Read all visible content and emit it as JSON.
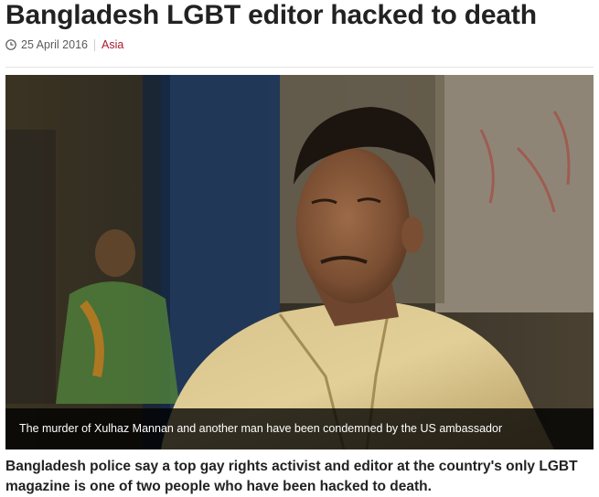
{
  "article": {
    "headline": "Bangladesh LGBT editor hacked to death",
    "date": "25 April 2016",
    "section": "Asia",
    "image": {
      "caption": "The murder of Xulhaz Mannan and another man have been condemned by the US ambassador"
    },
    "intro": "Bangladesh police say a top gay rights activist and editor at the country's only LGBT magazine is one of two people who have been hacked to death."
  },
  "icons": {
    "date": "clock-icon"
  },
  "colors": {
    "headline": "#222222",
    "section_link": "#a8192e",
    "meta_text": "#5a5a5a"
  }
}
